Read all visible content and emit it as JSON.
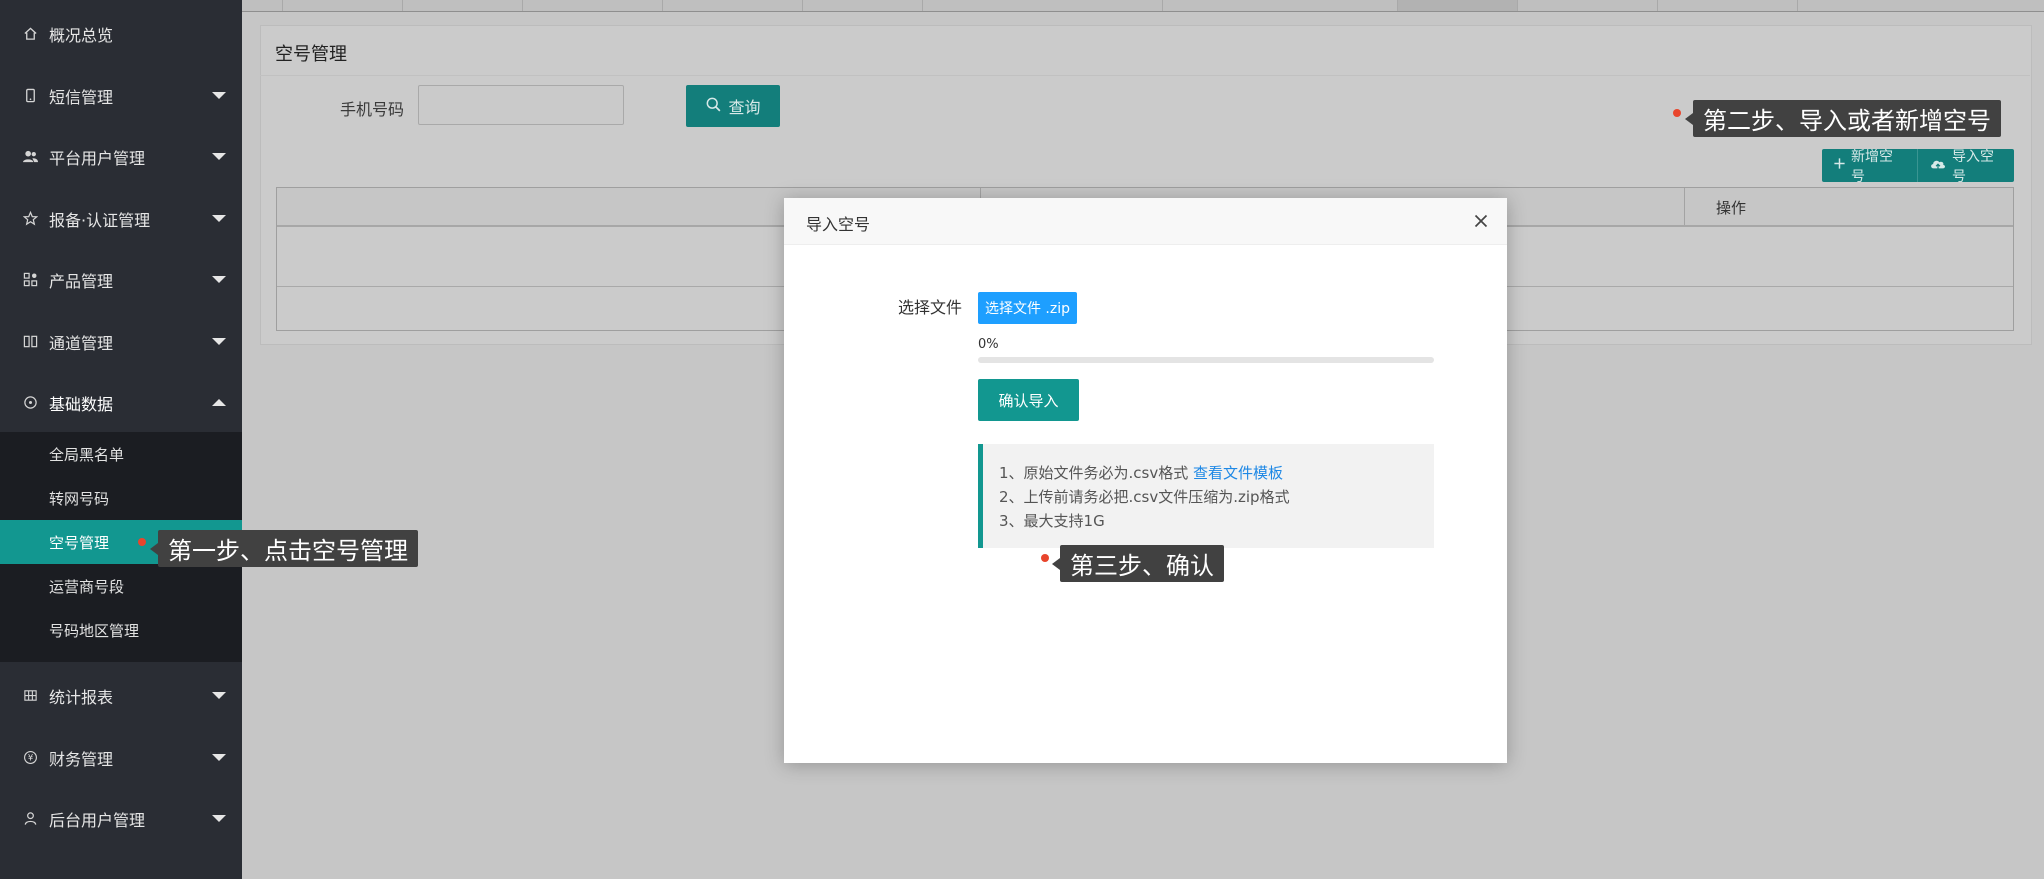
{
  "sidebar": {
    "items": [
      {
        "label": "概况总览",
        "icon": "home-icon"
      },
      {
        "label": "短信管理",
        "icon": "phone-icon"
      },
      {
        "label": "平台用户管理",
        "icon": "users-icon"
      },
      {
        "label": "报备·认证管理",
        "icon": "star-icon"
      },
      {
        "label": "产品管理",
        "icon": "grid-icon"
      },
      {
        "label": "通道管理",
        "icon": "columns-icon"
      },
      {
        "label": "基础数据",
        "icon": "database-icon"
      },
      {
        "label": "统计报表",
        "icon": "table-icon"
      },
      {
        "label": "财务管理",
        "icon": "yen-icon"
      },
      {
        "label": "后台用户管理",
        "icon": "user-icon"
      },
      {
        "label": "…",
        "icon": "more-icon"
      }
    ],
    "submenu": [
      "全局黑名单",
      "转网号码",
      "空号管理",
      "运营商号段",
      "号码地区管理"
    ],
    "active_sub": "空号管理"
  },
  "page": {
    "title": "空号管理",
    "phone_label": "手机号码",
    "phone_value": "",
    "query_label": "查询",
    "add_label": "新增空号",
    "import_label": "导入空号",
    "table_op_header": "操作"
  },
  "modal": {
    "title": "导入空号",
    "file_label": "选择文件",
    "choose_label": "选择文件 .zip",
    "progress_text": "0%",
    "progress_value": 0,
    "confirm_label": "确认导入",
    "note_line1": "1、原始文件务必为.csv格式 ",
    "note_link": "查看文件模板",
    "note_line2": "2、上传前请务必把.csv文件压缩为.zip格式",
    "note_line3": "3、最大支持1G"
  },
  "tips": {
    "step1": "第一步、点击空号管理",
    "step2": "第二步、导入或者新增空号",
    "step3": "第三步、确认"
  },
  "colors": {
    "sidebar_bg": "#2a2d34",
    "accent_teal": "#129790",
    "accent_blue": "#1e9fff",
    "link_blue": "#1e88e5",
    "marker_red": "#e8452c"
  }
}
